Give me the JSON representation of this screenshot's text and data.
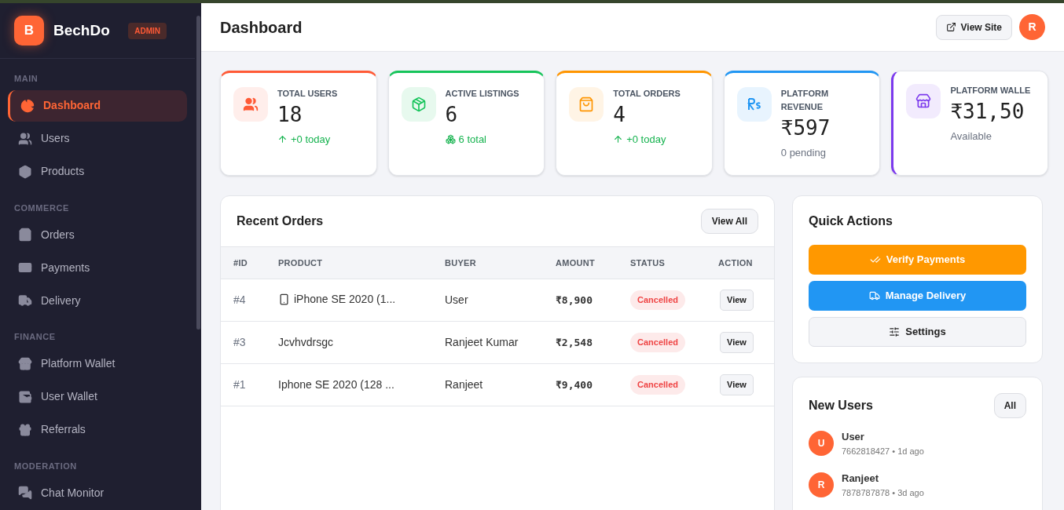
{
  "brand": {
    "initial": "B",
    "name": "BechDo",
    "badge": "ADMIN"
  },
  "sidebar": {
    "sections": [
      {
        "title": "MAIN",
        "items": [
          {
            "label": "Dashboard",
            "selected": true
          },
          {
            "label": "Users",
            "selected": false
          },
          {
            "label": "Products",
            "selected": false
          }
        ]
      },
      {
        "title": "COMMERCE",
        "items": [
          {
            "label": "Orders",
            "selected": false
          },
          {
            "label": "Payments",
            "selected": false
          },
          {
            "label": "Delivery",
            "selected": false
          }
        ]
      },
      {
        "title": "FINANCE",
        "items": [
          {
            "label": "Platform Wallet",
            "selected": false
          },
          {
            "label": "User Wallet",
            "selected": false
          },
          {
            "label": "Referrals",
            "selected": false
          }
        ]
      },
      {
        "title": "MODERATION",
        "items": [
          {
            "label": "Chat Monitor",
            "selected": false
          }
        ]
      }
    ]
  },
  "header": {
    "title": "Dashboard",
    "view_site": "View Site",
    "avatar": "R"
  },
  "stats": [
    {
      "label": "TOTAL USERS",
      "value": "18",
      "sub": {
        "text": "+0 today",
        "kind": "up"
      },
      "color": "#ff5a36",
      "accent_left": false
    },
    {
      "label": "ACTIVE LISTINGS",
      "value": "6",
      "sub": {
        "text": "6 total",
        "kind": "boxes"
      },
      "color": "#16c45a",
      "accent_left": false
    },
    {
      "label": "TOTAL ORDERS",
      "value": "4",
      "sub": {
        "text": "+0 today",
        "kind": "up"
      },
      "color": "#ff9500",
      "accent_left": false
    },
    {
      "label": "PLATFORM REVENUE",
      "value": "₹597",
      "sub": {
        "text": "0 pending",
        "kind": "plain"
      },
      "color": "#2196f3",
      "accent_left": false
    },
    {
      "label": "PLATFORM WALLE",
      "value": "₹31,50",
      "sub": {
        "text": "Available",
        "kind": "plain"
      },
      "color": "#7c3aed",
      "accent_left": true
    }
  ],
  "orders": {
    "title": "Recent Orders",
    "view_all": "View All",
    "columns": [
      "#ID",
      "PRODUCT",
      "BUYER",
      "AMOUNT",
      "STATUS",
      "ACTION"
    ],
    "rows": [
      {
        "id": "#4",
        "product": "iPhone SE 2020 (1...",
        "phone_emoji": true,
        "buyer": "User",
        "amount": "₹8,900",
        "status": "Cancelled",
        "action": "View"
      },
      {
        "id": "#3",
        "product": "Jcvhvdrsgc",
        "phone_emoji": false,
        "buyer": "Ranjeet Kumar",
        "amount": "₹2,548",
        "status": "Cancelled",
        "action": "View"
      },
      {
        "id": "#1",
        "product": "Iphone SE 2020 (128 ...",
        "phone_emoji": false,
        "buyer": "Ranjeet",
        "amount": "₹9,400",
        "status": "Cancelled",
        "action": "View"
      }
    ]
  },
  "quick_actions": {
    "title": "Quick Actions",
    "buttons": [
      {
        "label": "Verify Payments",
        "kind": "verify"
      },
      {
        "label": "Manage Delivery",
        "kind": "delivery"
      },
      {
        "label": "Settings",
        "kind": "settings"
      }
    ]
  },
  "new_users": {
    "title": "New Users",
    "all": "All",
    "users": [
      {
        "initial": "U",
        "name": "User",
        "meta": "7662818427 • 1d ago"
      },
      {
        "initial": "R",
        "name": "Ranjeet",
        "meta": "7878787878 • 3d ago"
      }
    ]
  }
}
